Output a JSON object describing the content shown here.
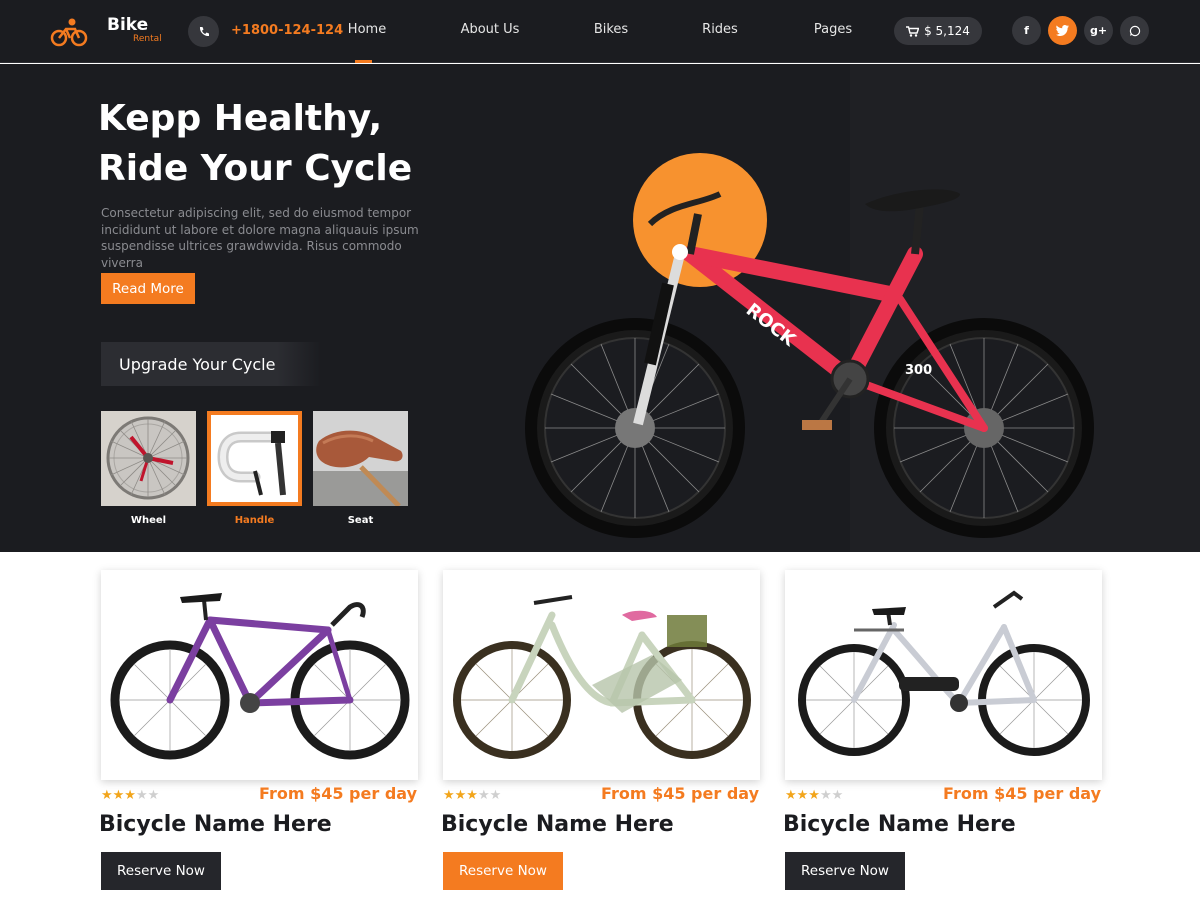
{
  "brand": {
    "title": "Bike",
    "subtitle": "Rental",
    "accent": "#f47b20"
  },
  "header": {
    "phone": "+1800-124-124",
    "nav": [
      {
        "label": "Home",
        "active": true
      },
      {
        "label": "About Us"
      },
      {
        "label": "Bikes"
      },
      {
        "label": "Rides"
      },
      {
        "label": "Pages"
      }
    ],
    "cart_amount": "$ 5,124",
    "social": [
      {
        "icon": "facebook-icon",
        "glyph": "f"
      },
      {
        "icon": "twitter-icon",
        "glyph": "t",
        "active": true
      },
      {
        "icon": "google-plus-icon",
        "glyph": "g+"
      },
      {
        "icon": "whatsapp-icon",
        "glyph": "w"
      }
    ]
  },
  "hero": {
    "title_line1": "Kepp Healthy,",
    "title_line2": "Ride Your Cycle",
    "description": "Consectetur adipiscing elit, sed do eiusmod tempor incididunt ut labore et dolore magna aliquauis ipsum suspendisse ultrices grawdwvida. Risus commodo viverra",
    "cta": "Read More",
    "upgrade_label": "Upgrade Your Cycle",
    "parts": [
      {
        "label": "Wheel"
      },
      {
        "label": "Handle",
        "active": true
      },
      {
        "label": "Seat"
      }
    ]
  },
  "products": [
    {
      "name": "Bicycle Name Here",
      "price": "From $45 per day",
      "rating": 3,
      "max_rating": 5,
      "cta": "Reserve Now",
      "frame_color": "#7b3fa0"
    },
    {
      "name": "Bicycle Name Here",
      "price": "From $45 per day",
      "rating": 3,
      "max_rating": 5,
      "cta": "Reserve Now",
      "cta_active": true,
      "frame_color": "#c8d4bd"
    },
    {
      "name": "Bicycle Name Here",
      "price": "From $45 per day",
      "rating": 3,
      "max_rating": 5,
      "cta": "Reserve Now",
      "frame_color": "#c9ccd4"
    }
  ]
}
